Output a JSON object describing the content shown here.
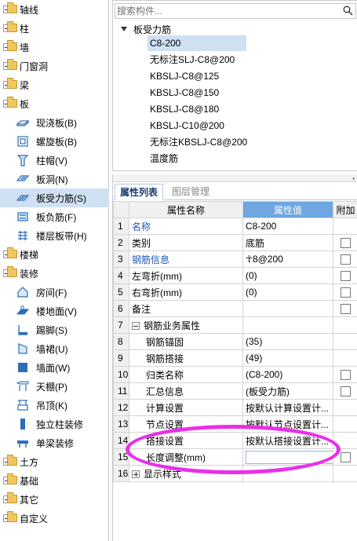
{
  "left_nav": {
    "groups": [
      {
        "label": "轴线",
        "expanded": false
      },
      {
        "label": "柱",
        "expanded": false
      },
      {
        "label": "墙",
        "expanded": false
      },
      {
        "label": "门窗洞",
        "expanded": false
      },
      {
        "label": "梁",
        "expanded": false
      },
      {
        "label": "板",
        "expanded": true
      },
      {
        "label": "楼梯",
        "expanded": false
      },
      {
        "label": "装修",
        "expanded": true
      },
      {
        "label": "土方",
        "expanded": false
      },
      {
        "label": "基础",
        "expanded": false
      },
      {
        "label": "其它",
        "expanded": false
      },
      {
        "label": "自定义",
        "expanded": false
      }
    ],
    "slab_items": [
      {
        "label": "现浇板(B)",
        "icon": "slab-icon"
      },
      {
        "label": "螺旋板(B)",
        "icon": "spiral-slab-icon"
      },
      {
        "label": "柱帽(V)",
        "icon": "column-cap-icon"
      },
      {
        "label": "板洞(N)",
        "icon": "slab-opening-icon"
      },
      {
        "label": "板受力筋(S)",
        "icon": "slab-rebar-icon",
        "selected": true
      },
      {
        "label": "板负筋(F)",
        "icon": "negative-rebar-icon"
      },
      {
        "label": "楼层板带(H)",
        "icon": "slab-strip-icon"
      }
    ],
    "decor_items": [
      {
        "label": "房间(F)",
        "icon": "room-icon"
      },
      {
        "label": "楼地面(V)",
        "icon": "floor-icon"
      },
      {
        "label": "踢脚(S)",
        "icon": "skirting-icon"
      },
      {
        "label": "墙裙(U)",
        "icon": "dado-icon"
      },
      {
        "label": "墙面(W)",
        "icon": "wall-surface-icon"
      },
      {
        "label": "天棚(P)",
        "icon": "ceiling-icon"
      },
      {
        "label": "吊顶(K)",
        "icon": "suspended-ceiling-icon"
      },
      {
        "label": "独立柱装修",
        "icon": "column-finish-icon"
      },
      {
        "label": "单梁装修",
        "icon": "beam-finish-icon"
      }
    ]
  },
  "component_tree": {
    "search_placeholder": "搜索构件...",
    "root_label": "板受力筋",
    "items": [
      {
        "label": "C8-200",
        "selected": true
      },
      {
        "label": "无标注SLJ-C8@200"
      },
      {
        "label": "KBSLJ-C8@125"
      },
      {
        "label": "KBSLJ-C8@150"
      },
      {
        "label": "KBSLJ-C8@180"
      },
      {
        "label": "KBSLJ-C10@200"
      },
      {
        "label": "无标注KBSLJ-C8@200"
      },
      {
        "label": "温度筋"
      }
    ]
  },
  "properties": {
    "tabs": [
      "属性列表",
      "图层管理"
    ],
    "headers": {
      "name": "属性名称",
      "value": "属性值",
      "extra": "附加"
    },
    "rows": [
      {
        "num": "1",
        "name": "名称",
        "value": "C8-200",
        "blue": true,
        "check": false
      },
      {
        "num": "2",
        "name": "类别",
        "value": "底筋",
        "check": true
      },
      {
        "num": "3",
        "name": "钢筋信息",
        "value": "☥8@200",
        "blue": true,
        "check": true
      },
      {
        "num": "4",
        "name": "左弯折(mm)",
        "value": "(0)",
        "check": true
      },
      {
        "num": "5",
        "name": "右弯折(mm)",
        "value": "(0)",
        "check": true
      },
      {
        "num": "6",
        "name": "备注",
        "value": "",
        "check": true
      },
      {
        "num": "7",
        "name": "钢筋业务属性",
        "value": "",
        "group": "minus",
        "check": false
      },
      {
        "num": "8",
        "name": "钢筋锚固",
        "value": "(35)",
        "child": true,
        "check": false
      },
      {
        "num": "9",
        "name": "钢筋搭接",
        "value": "(49)",
        "child": true,
        "check": false
      },
      {
        "num": "10",
        "name": "归类名称",
        "value": "(C8-200)",
        "child": true,
        "check": true
      },
      {
        "num": "11",
        "name": "汇总信息",
        "value": "(板受力筋)",
        "child": true,
        "check": true
      },
      {
        "num": "12",
        "name": "计算设置",
        "value": "按默认计算设置计...",
        "child": true,
        "check": false
      },
      {
        "num": "13",
        "name": "节点设置",
        "value": "按默认节点设置计...",
        "child": true,
        "check": false
      },
      {
        "num": "14",
        "name": "搭接设置",
        "value": "按默认搭接设置计...",
        "child": true,
        "check": false
      },
      {
        "num": "15",
        "name": "长度调整(mm)",
        "value": "",
        "child": true,
        "editing": true,
        "check": true
      },
      {
        "num": "16",
        "name": "显示样式",
        "value": "",
        "group": "plus",
        "check": false
      }
    ]
  },
  "annotation": {
    "color": "#e830e8",
    "shape": "ellipse"
  }
}
